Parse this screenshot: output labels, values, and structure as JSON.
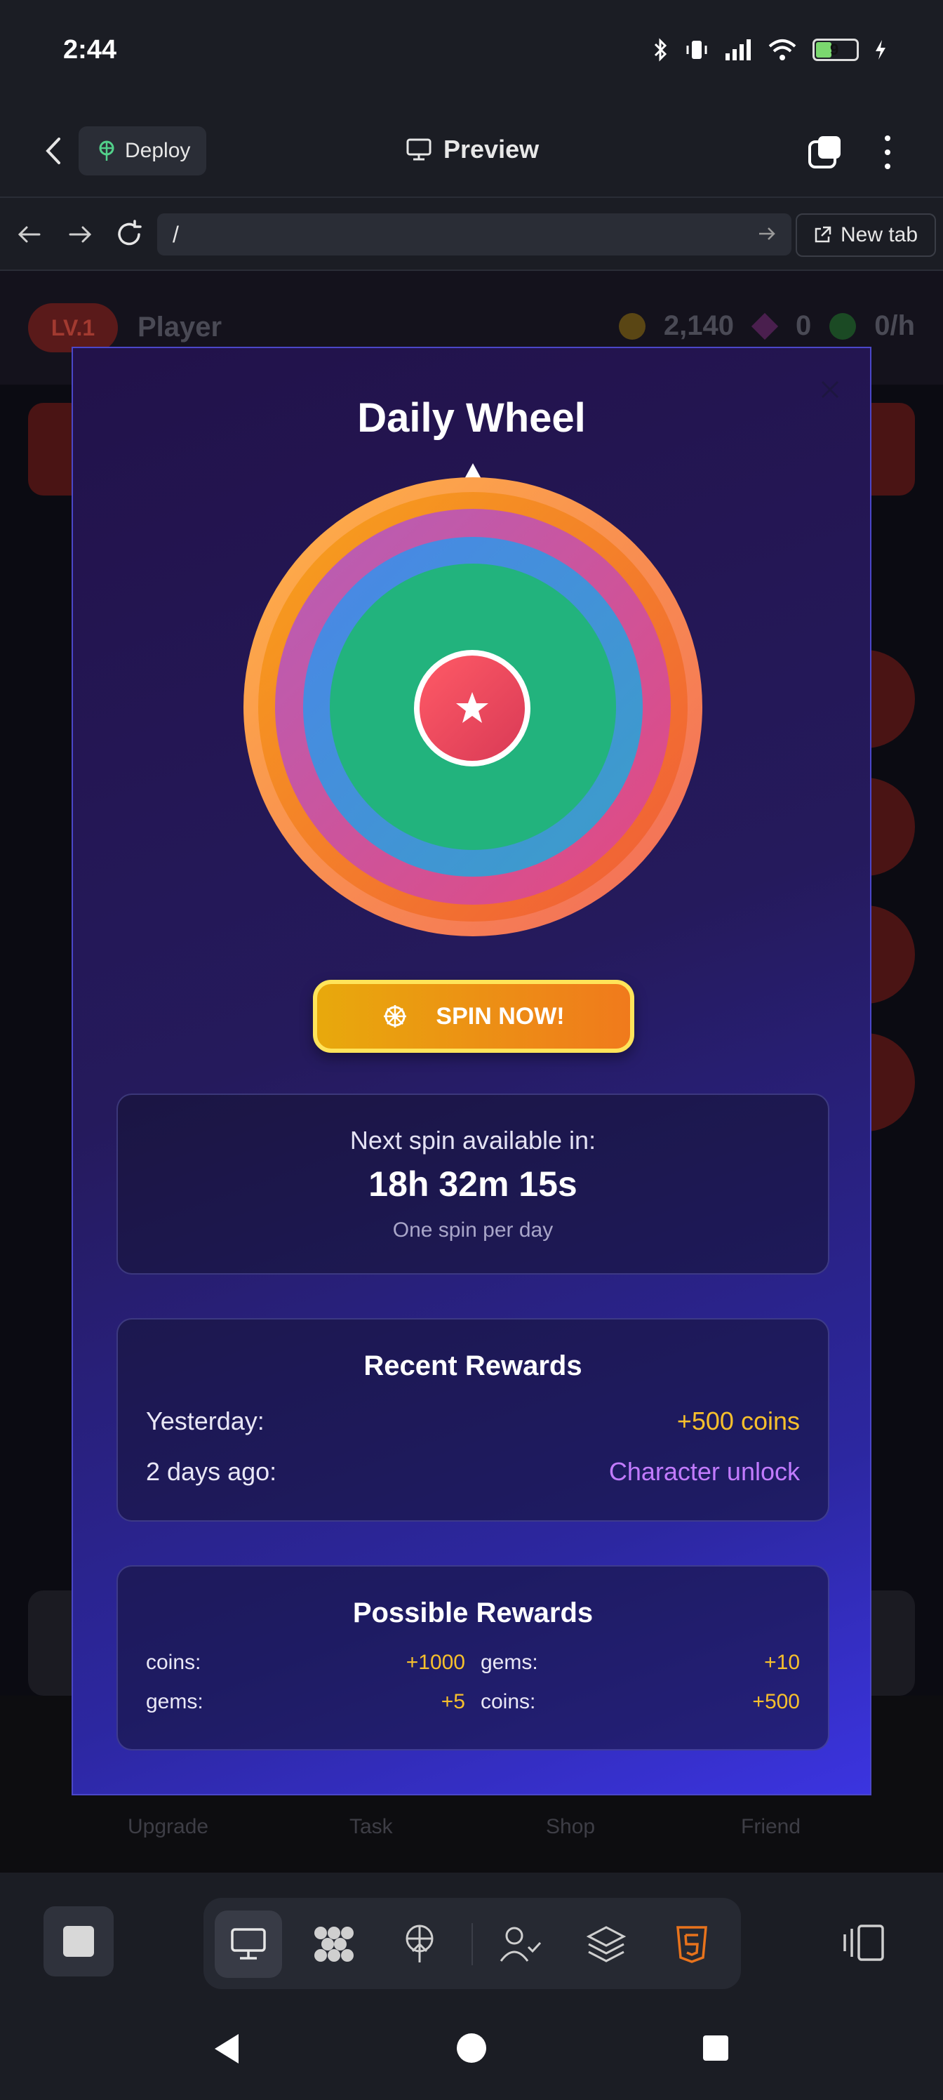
{
  "status_bar": {
    "time": "2:44",
    "battery": "9"
  },
  "header": {
    "deploy_label": "Deploy",
    "preview_label": "Preview"
  },
  "url_bar": {
    "url": "/",
    "new_tab_label": "New tab"
  },
  "background_app": {
    "level_badge": "LV.1",
    "player_name": "Player",
    "coins": "2,140",
    "gems": "0",
    "rate": "0/h",
    "nav_labels": [
      "Upgrade",
      "Task",
      "Shop",
      "Friend"
    ]
  },
  "modal": {
    "title": "Daily Wheel",
    "spin_button": "SPIN NOW!",
    "next_spin": {
      "label": "Next spin available in:",
      "timer": "18h 32m 15s",
      "note": "One spin per day"
    },
    "recent_rewards": {
      "title": "Recent Rewards",
      "items": [
        {
          "when": "Yesterday:",
          "reward": "+500 coins"
        },
        {
          "when": "2 days ago:",
          "reward": "Character unlock"
        }
      ]
    },
    "possible_rewards": {
      "title": "Possible Rewards",
      "items": [
        {
          "name": "coins:",
          "value": "+1000"
        },
        {
          "name": "gems:",
          "value": "+10"
        },
        {
          "name": "gems:",
          "value": "+5"
        },
        {
          "name": "coins:",
          "value": "+500"
        }
      ]
    }
  },
  "colors": {
    "gold": "#f7c02c",
    "purple": "#c27bff",
    "spin_yellow": "#ffe45a",
    "modal_border": "#4b47c9",
    "wheel_rings": [
      "#ffb347",
      "#f7812a",
      "#c45ea8",
      "#4a86e0",
      "#22b37d"
    ]
  }
}
